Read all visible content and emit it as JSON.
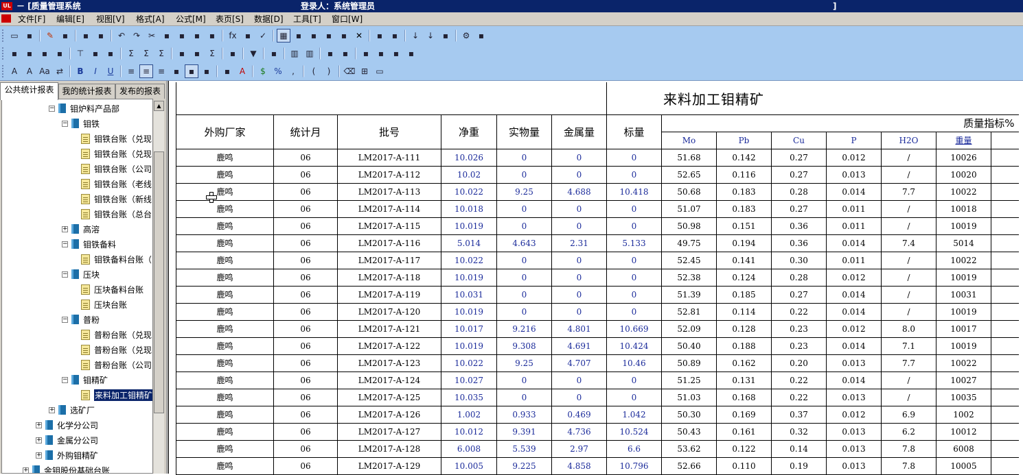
{
  "titlebar": {
    "app": "UL",
    "title": "－ [质量管理系统",
    "user": "登录人：系统管理员",
    "bracket": "]"
  },
  "menu": [
    "文件[F]",
    "编辑[E]",
    "视图[V]",
    "格式[A]",
    "公式[M]",
    "表页[S]",
    "数据[D]",
    "工具[T]",
    "窗口[W]"
  ],
  "toolbar": {
    "row1": [
      "open-icon",
      "save-icon",
      "|",
      "edit-pen-icon",
      "save-disk-icon",
      "|",
      "copy-doc-icon",
      "word-export-icon",
      "|",
      "undo-icon",
      "redo-icon",
      "cut-icon",
      "copy-icon",
      "paste-icon",
      "format-brush-icon",
      "spellcheck-icon",
      "|",
      "fx-icon",
      "calc-icon",
      "check-icon",
      "|",
      "grid-view-icon",
      "sheet-icon",
      "page-icon",
      "excel-export-icon",
      "print-icon",
      "delete-icon",
      "|",
      "folder-icon",
      "clear-icon",
      "|",
      "sort-asc-icon",
      "sort-desc-icon",
      "save-as-icon",
      "|",
      "settings-icon",
      "exit-icon"
    ],
    "row2": [
      "insert-row-icon",
      "insert-col-icon",
      "move-down-icon",
      "move-right-icon",
      "|",
      "filter-icon",
      "group-icon",
      "sub-icon",
      "|",
      "sum-icon",
      "sum2-icon",
      "sum3-icon",
      "|",
      "folder-open-icon",
      "folder-save-icon",
      "sigma-icon",
      "|",
      "link-icon",
      "|",
      "dropdown-icon",
      "|",
      "lock-icon",
      "|",
      "barcode-icon",
      "chart-icon",
      "|",
      "info-icon",
      "refresh-icon",
      "|",
      "table1-icon",
      "table2-icon",
      "table3-icon",
      "table4-icon"
    ],
    "row3": [
      "font-icon",
      "font-size-icon",
      "font-style-icon",
      "swap-icon",
      "|",
      "bold-icon",
      "italic-icon",
      "underline-icon",
      "|",
      "align-left-icon",
      "align-center-icon",
      "align-right-icon",
      "vert-top-icon",
      "vert-mid-icon",
      "vert-bot-icon",
      "|",
      "fill-color-icon",
      "font-color-icon",
      "|",
      "currency-icon",
      "percent-icon",
      "comma-icon",
      "|",
      "paren-open-icon",
      "paren-close-icon",
      "|",
      "eraser-icon",
      "border-icon",
      "rect-icon"
    ],
    "glyphs": {
      "A": "A",
      "B": "B",
      "I": "I",
      "U": "U",
      "$": "$",
      "%": "%",
      "fx": "fx",
      "sigma": "Σ"
    }
  },
  "sidebar": {
    "tabs": [
      "公共统计报表",
      "我的统计报表",
      "发布的报表"
    ],
    "tree": [
      {
        "level": 2,
        "type": "book",
        "pm": "−",
        "label": "钼炉料产品部"
      },
      {
        "level": 3,
        "type": "book",
        "pm": "−",
        "label": "钼铁"
      },
      {
        "level": 4,
        "type": "doc",
        "label": "钼铁台账（兑现"
      },
      {
        "level": 4,
        "type": "doc",
        "label": "钼铁台账（兑现"
      },
      {
        "level": 4,
        "type": "doc",
        "label": "钼铁台账（公司"
      },
      {
        "level": 4,
        "type": "doc",
        "label": "钼铁台账（老线"
      },
      {
        "level": 4,
        "type": "doc",
        "label": "钼铁台账（新线"
      },
      {
        "level": 4,
        "type": "doc",
        "label": "钼铁台账（总台"
      },
      {
        "level": 3,
        "type": "book",
        "pm": "+",
        "label": "高溶"
      },
      {
        "level": 3,
        "type": "book",
        "pm": "−",
        "label": "钼铁备料"
      },
      {
        "level": 4,
        "type": "doc",
        "label": "钼铁备料台账（"
      },
      {
        "level": 3,
        "type": "book",
        "pm": "−",
        "label": "压块"
      },
      {
        "level": 4,
        "type": "doc",
        "label": "压块备料台账"
      },
      {
        "level": 4,
        "type": "doc",
        "label": "压块台账"
      },
      {
        "level": 3,
        "type": "book",
        "pm": "−",
        "label": "普粉"
      },
      {
        "level": 4,
        "type": "doc",
        "label": "普粉台账（兑现"
      },
      {
        "level": 4,
        "type": "doc",
        "label": "普粉台账（兑现"
      },
      {
        "level": 4,
        "type": "doc",
        "label": "普粉台账（公司"
      },
      {
        "level": 3,
        "type": "book",
        "pm": "−",
        "label": "钼精矿"
      },
      {
        "level": 4,
        "type": "edit",
        "label": "来料加工钼精矿",
        "selected": true
      },
      {
        "level": 2,
        "type": "book",
        "pm": "+",
        "label": "选矿厂"
      },
      {
        "level": 1,
        "type": "book",
        "pm": "+",
        "label": "化学分公司"
      },
      {
        "level": 1,
        "type": "book",
        "pm": "+",
        "label": "金属分公司"
      },
      {
        "level": 1,
        "type": "book",
        "pm": "+",
        "label": "外购钼精矿"
      },
      {
        "level": 0,
        "type": "book",
        "pm": "+",
        "label": "金钼股份基础台账"
      }
    ]
  },
  "report": {
    "title": "来料加工钼精矿",
    "headers": {
      "vendor": "外购厂家",
      "month": "统计月",
      "batch": "批号",
      "net": "净重",
      "actual": "实物量",
      "metal": "金属量",
      "std": "标量",
      "quality": "质量指标%",
      "mo": "Mo",
      "pb": "Pb",
      "cu": "Cu",
      "p": "P",
      "h2o": "H2O",
      "weight": "重量"
    },
    "rows": [
      [
        "鹿鸣",
        "06",
        "LM2017-A-111",
        "10.026",
        "0",
        "0",
        "0",
        "51.68",
        "0.142",
        "0.27",
        "0.012",
        "/",
        "10026"
      ],
      [
        "鹿鸣",
        "06",
        "LM2017-A-112",
        "10.02",
        "0",
        "0",
        "0",
        "52.65",
        "0.116",
        "0.27",
        "0.013",
        "/",
        "10020"
      ],
      [
        "鹿鸣",
        "06",
        "LM2017-A-113",
        "10.022",
        "9.25",
        "4.688",
        "10.418",
        "50.68",
        "0.183",
        "0.28",
        "0.014",
        "7.7",
        "10022"
      ],
      [
        "鹿鸣",
        "06",
        "LM2017-A-114",
        "10.018",
        "0",
        "0",
        "0",
        "51.07",
        "0.183",
        "0.27",
        "0.011",
        "/",
        "10018"
      ],
      [
        "鹿鸣",
        "06",
        "LM2017-A-115",
        "10.019",
        "0",
        "0",
        "0",
        "50.98",
        "0.151",
        "0.36",
        "0.011",
        "/",
        "10019"
      ],
      [
        "鹿鸣",
        "06",
        "LM2017-A-116",
        "5.014",
        "4.643",
        "2.31",
        "5.133",
        "49.75",
        "0.194",
        "0.36",
        "0.014",
        "7.4",
        "5014"
      ],
      [
        "鹿鸣",
        "06",
        "LM2017-A-117",
        "10.022",
        "0",
        "0",
        "0",
        "52.45",
        "0.141",
        "0.30",
        "0.011",
        "/",
        "10022"
      ],
      [
        "鹿鸣",
        "06",
        "LM2017-A-118",
        "10.019",
        "0",
        "0",
        "0",
        "52.38",
        "0.124",
        "0.28",
        "0.012",
        "/",
        "10019"
      ],
      [
        "鹿鸣",
        "06",
        "LM2017-A-119",
        "10.031",
        "0",
        "0",
        "0",
        "51.39",
        "0.185",
        "0.27",
        "0.014",
        "/",
        "10031"
      ],
      [
        "鹿鸣",
        "06",
        "LM2017-A-120",
        "10.019",
        "0",
        "0",
        "0",
        "52.81",
        "0.114",
        "0.22",
        "0.014",
        "/",
        "10019"
      ],
      [
        "鹿鸣",
        "06",
        "LM2017-A-121",
        "10.017",
        "9.216",
        "4.801",
        "10.669",
        "52.09",
        "0.128",
        "0.23",
        "0.012",
        "8.0",
        "10017"
      ],
      [
        "鹿鸣",
        "06",
        "LM2017-A-122",
        "10.019",
        "9.308",
        "4.691",
        "10.424",
        "50.40",
        "0.188",
        "0.23",
        "0.014",
        "7.1",
        "10019"
      ],
      [
        "鹿鸣",
        "06",
        "LM2017-A-123",
        "10.022",
        "9.25",
        "4.707",
        "10.46",
        "50.89",
        "0.162",
        "0.20",
        "0.013",
        "7.7",
        "10022"
      ],
      [
        "鹿鸣",
        "06",
        "LM2017-A-124",
        "10.027",
        "0",
        "0",
        "0",
        "51.25",
        "0.131",
        "0.22",
        "0.014",
        "/",
        "10027"
      ],
      [
        "鹿鸣",
        "06",
        "LM2017-A-125",
        "10.035",
        "0",
        "0",
        "0",
        "51.03",
        "0.168",
        "0.22",
        "0.013",
        "/",
        "10035"
      ],
      [
        "鹿鸣",
        "06",
        "LM2017-A-126",
        "1.002",
        "0.933",
        "0.469",
        "1.042",
        "50.30",
        "0.169",
        "0.37",
        "0.012",
        "6.9",
        "1002"
      ],
      [
        "鹿鸣",
        "06",
        "LM2017-A-127",
        "10.012",
        "9.391",
        "4.736",
        "10.524",
        "50.43",
        "0.161",
        "0.32",
        "0.013",
        "6.2",
        "10012"
      ],
      [
        "鹿鸣",
        "06",
        "LM2017-A-128",
        "6.008",
        "5.539",
        "2.97",
        "6.6",
        "53.62",
        "0.122",
        "0.14",
        "0.013",
        "7.8",
        "6008"
      ],
      [
        "鹿鸣",
        "06",
        "LM2017-A-129",
        "10.005",
        "9.225",
        "4.858",
        "10.796",
        "52.66",
        "0.110",
        "0.19",
        "0.013",
        "7.8",
        "10005"
      ]
    ]
  },
  "colors": {
    "titlebar": "#0a246a",
    "toolbar": "#a6caf0",
    "menubar": "#d4d0c8",
    "selection": "#0a246a",
    "datablue": "#1a2a9a"
  }
}
